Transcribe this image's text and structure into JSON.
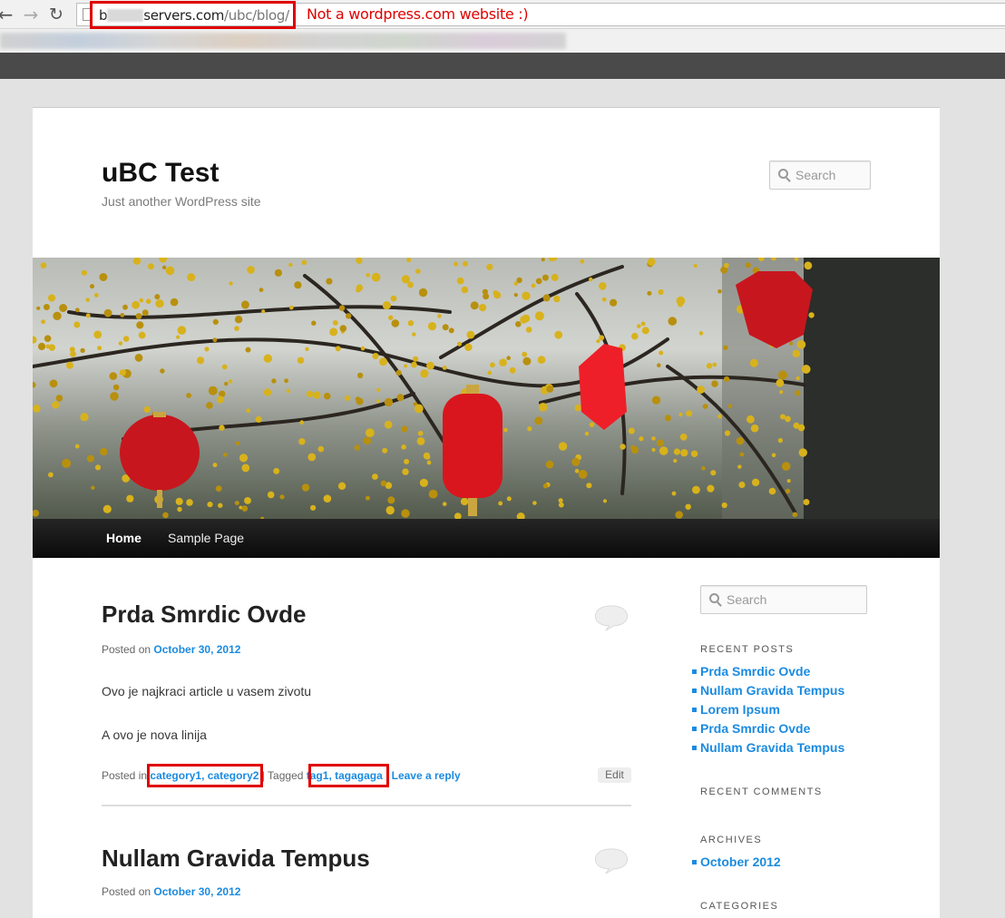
{
  "browser": {
    "url_prefix": "b",
    "url_domain": "servers.com",
    "url_path": "/ubc/blog/",
    "annotation": "Not a wordpress.com website :)"
  },
  "site": {
    "title": "uBC Test",
    "description": "Just another WordPress site",
    "search_placeholder": "Search"
  },
  "menu": {
    "home": "Home",
    "sample": "Sample Page"
  },
  "posts": [
    {
      "title": "Prda Smrdic Ovde",
      "posted_on": "Posted on",
      "date": "October 30, 2012",
      "body": [
        "Ovo je najkraci article u vasem zivotu",
        "A ovo je nova linija"
      ],
      "footer": {
        "posted_in": "Posted in",
        "categories": "category1, category2",
        "sep": "|",
        "tagged": "Tagged",
        "tags": "tag1, tagagaga",
        "sep2": "|",
        "reply": "Leave a reply",
        "edit": "Edit"
      }
    },
    {
      "title": "Nullam Gravida Tempus",
      "posted_on": "Posted on",
      "date": "October 30, 2012"
    }
  ],
  "sidebar": {
    "search_placeholder": "Search",
    "recent_posts_title": "RECENT POSTS",
    "recent_posts": [
      "Prda Smrdic Ovde",
      "Nullam Gravida Tempus",
      "Lorem Ipsum",
      "Prda Smrdic Ovde",
      "Nullam Gravida Tempus"
    ],
    "recent_comments_title": "RECENT COMMENTS",
    "archives_title": "ARCHIVES",
    "archives": [
      "October 2012"
    ],
    "categories_title": "CATEGORIES"
  },
  "colors": {
    "link": "#1b8be0",
    "annotation": "#e00000"
  }
}
